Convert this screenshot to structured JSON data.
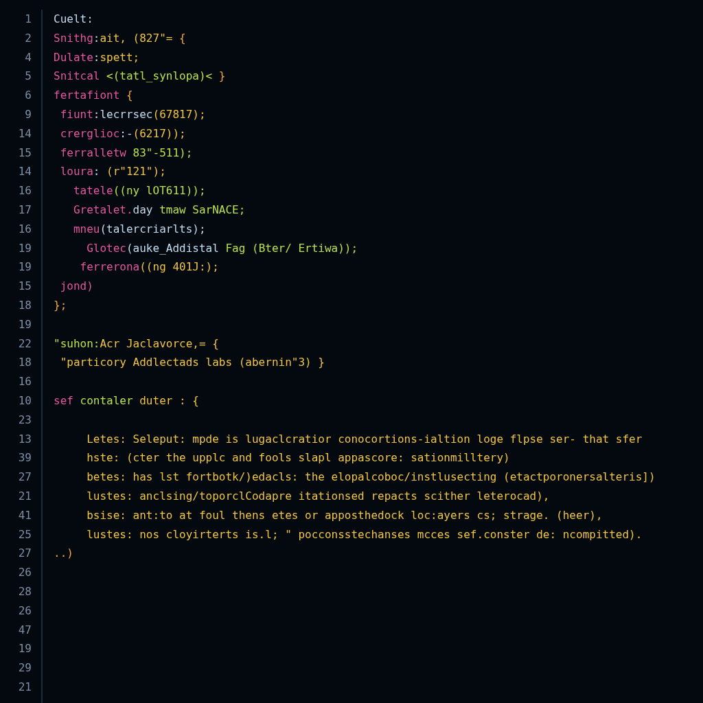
{
  "editor": {
    "lines": [
      {
        "number": "1",
        "code": [
          {
            "kind": "plain",
            "text": "Cuelt:"
          }
        ]
      },
      {
        "number": "2",
        "code": [
          {
            "kind": "keyword",
            "text": "Snithg"
          },
          {
            "kind": "plain",
            "text": ":"
          },
          {
            "kind": "string",
            "text": "ait, (827\"= "
          },
          {
            "kind": "punct",
            "text": "{"
          }
        ]
      },
      {
        "number": "4",
        "code": [
          {
            "kind": "keyword",
            "text": "Dulate"
          },
          {
            "kind": "plain",
            "text": ":"
          },
          {
            "kind": "string",
            "text": "spett;"
          }
        ]
      },
      {
        "number": "5",
        "code": [
          {
            "kind": "keyword",
            "text": "Snitcal "
          },
          {
            "kind": "func",
            "text": "<(tatl_synlopa)< "
          },
          {
            "kind": "punct",
            "text": "}"
          }
        ]
      },
      {
        "number": "6",
        "code": [
          {
            "kind": "keyword",
            "text": "fertafiont "
          },
          {
            "kind": "punct",
            "text": "{"
          }
        ]
      },
      {
        "number": "9",
        "code": [
          {
            "kind": "keyword",
            "text": " fiunt"
          },
          {
            "kind": "plain",
            "text": ":lecrrsec"
          },
          {
            "kind": "string",
            "text": "(67817);"
          }
        ]
      },
      {
        "number": "14",
        "code": [
          {
            "kind": "keyword",
            "text": " crerglioc"
          },
          {
            "kind": "plain",
            "text": ":-"
          },
          {
            "kind": "string",
            "text": "(6217));"
          }
        ]
      },
      {
        "number": "15",
        "code": [
          {
            "kind": "keyword",
            "text": " ferralletw"
          },
          {
            "kind": "func",
            "text": " 83\"-511);"
          }
        ]
      },
      {
        "number": "14",
        "code": [
          {
            "kind": "keyword",
            "text": " loura"
          },
          {
            "kind": "plain",
            "text": ": "
          },
          {
            "kind": "string",
            "text": "(r\"121\");"
          }
        ]
      },
      {
        "number": "16",
        "code": [
          {
            "kind": "keyword",
            "text": "   tatele"
          },
          {
            "kind": "func",
            "text": "((ny lOT611));"
          }
        ]
      },
      {
        "number": "17",
        "code": [
          {
            "kind": "keyword",
            "text": "   Gretalet."
          },
          {
            "kind": "plain",
            "text": "day "
          },
          {
            "kind": "func",
            "text": "tmaw SarNACE;"
          }
        ]
      },
      {
        "number": "16",
        "code": [
          {
            "kind": "keyword",
            "text": "   mneu"
          },
          {
            "kind": "plain",
            "text": "(talercriarlts);"
          }
        ]
      },
      {
        "number": "19",
        "code": [
          {
            "kind": "keyword",
            "text": "     Glotec"
          },
          {
            "kind": "plain",
            "text": "(auke_Addistal "
          },
          {
            "kind": "func",
            "text": "Fag (Bter/ Ertiwa));"
          }
        ]
      },
      {
        "number": "19",
        "code": [
          {
            "kind": "keyword",
            "text": "    ferrerona"
          },
          {
            "kind": "string",
            "text": "((ng 401J:);"
          }
        ]
      },
      {
        "number": "15",
        "code": [
          {
            "kind": "keyword",
            "text": " jond)"
          }
        ]
      },
      {
        "number": "18",
        "code": [
          {
            "kind": "punct",
            "text": "};"
          }
        ]
      },
      {
        "number": "19"
      },
      {
        "number": "22",
        "code": [
          {
            "kind": "func",
            "text": "\"suhon:"
          },
          {
            "kind": "string",
            "text": "Acr Jaclavorce,= {"
          }
        ]
      },
      {
        "number": "18",
        "code": [
          {
            "kind": "string",
            "text": " \"particory Addlectads labs (abernin\"3) }"
          }
        ]
      },
      {
        "number": "16"
      },
      {
        "number": "10",
        "code": [
          {
            "kind": "keyword",
            "text": "sef "
          },
          {
            "kind": "func",
            "text": "contaler "
          },
          {
            "kind": "string",
            "text": "duter : {"
          }
        ]
      },
      {
        "number": "23"
      },
      {
        "number": "13",
        "code": [
          {
            "kind": "string",
            "text": "     Letes: Seleput: mpde is lugaclcratior conocortions-ialtion loge flpse ser- that sfer"
          }
        ]
      },
      {
        "number": "39",
        "code": [
          {
            "kind": "string",
            "text": "     hste: (cter the upplc and fools slapl appascore: sationmilltery)"
          }
        ]
      },
      {
        "number": "27",
        "code": [
          {
            "kind": "string",
            "text": "     betes: has lst fortbotk/)edacls: the elopalcoboc/instlusecting (etactporonersalteris])"
          }
        ]
      },
      {
        "number": "21",
        "code": [
          {
            "kind": "string",
            "text": "     lustes: anclsing/toporclCodapre itationsed repacts scither leterocad),"
          }
        ]
      },
      {
        "number": "41",
        "code": [
          {
            "kind": "string",
            "text": "     bsise: ant:to at foul thens etes or apposthedock loc:ayers cs; strage. (heer),"
          }
        ]
      },
      {
        "number": "25",
        "code": [
          {
            "kind": "string",
            "text": "     lustes: nos cloyirterts is.l; \" pocconsstechanses mcces sef.conster de: ncompitted)."
          }
        ]
      },
      {
        "number": "27",
        "code": [
          {
            "kind": "punct",
            "text": "..)"
          }
        ]
      },
      {
        "number": "26"
      },
      {
        "number": "28"
      },
      {
        "number": "26"
      },
      {
        "number": "47"
      },
      {
        "number": "19"
      },
      {
        "number": "29"
      },
      {
        "number": "21"
      }
    ]
  }
}
